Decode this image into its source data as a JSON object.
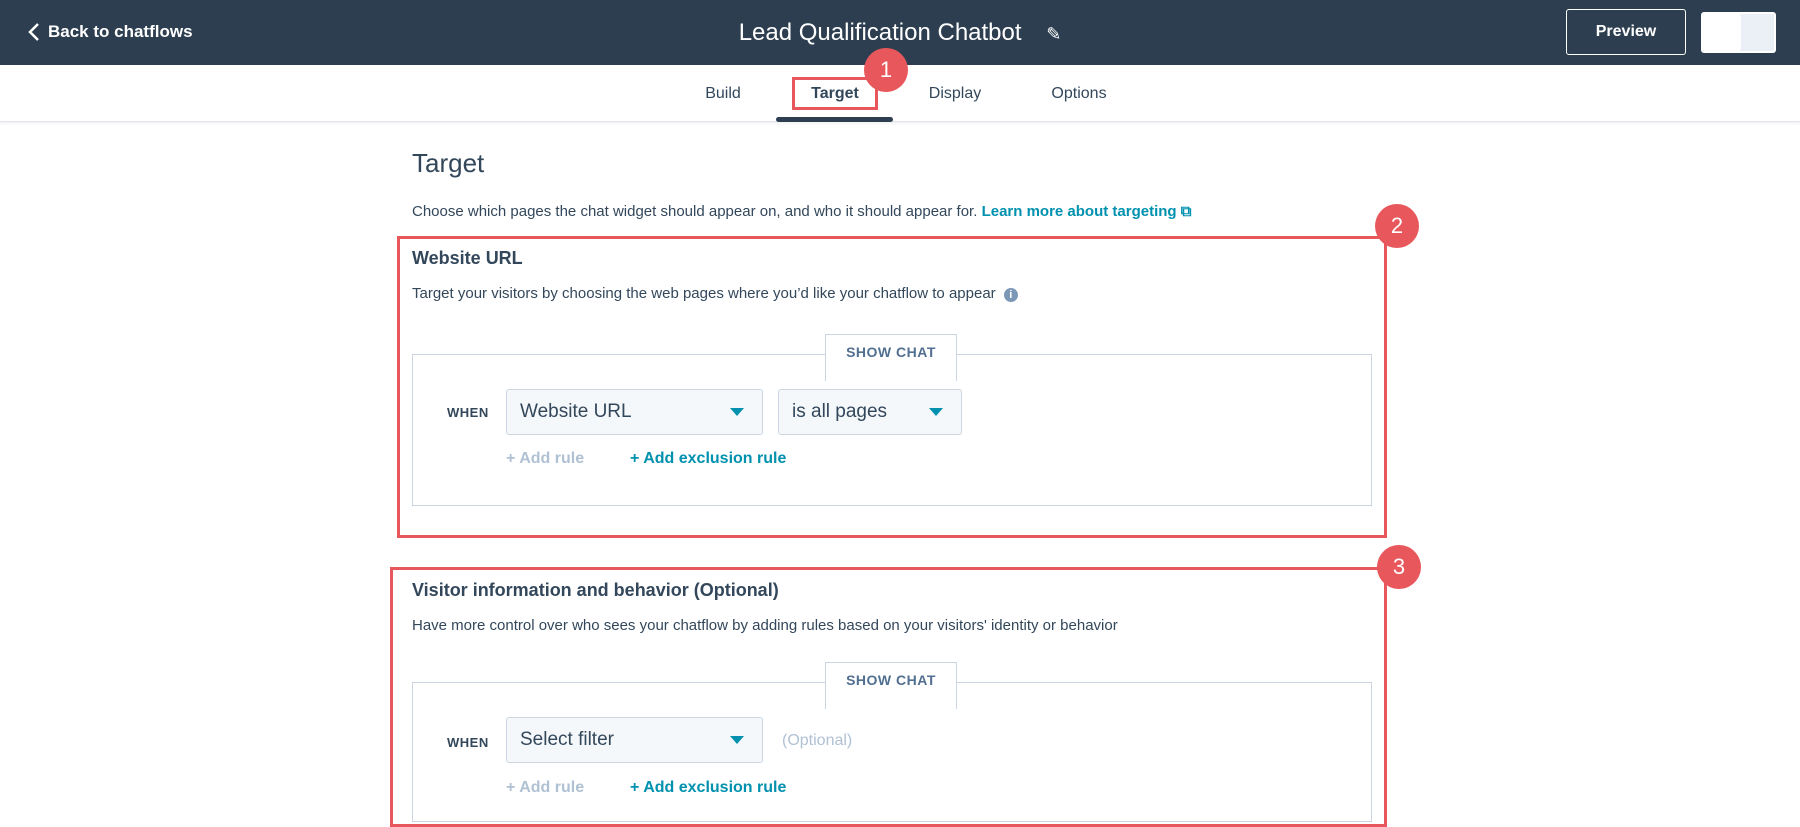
{
  "header": {
    "back_label": "Back to chatflows",
    "title": "Lead Qualification Chatbot",
    "preview_label": "Preview"
  },
  "tabs": [
    {
      "label": "Build"
    },
    {
      "label": "Target"
    },
    {
      "label": "Display"
    },
    {
      "label": "Options"
    }
  ],
  "annotations": [
    "1",
    "2",
    "3"
  ],
  "page": {
    "title": "Target",
    "description": "Choose which pages the chat widget should appear on, and who it should appear for.",
    "learn_more": "Learn more about targeting"
  },
  "website_url": {
    "heading": "Website URL",
    "description": "Target your visitors by choosing the web pages where you’d like your chatflow to appear",
    "show_chat": "SHOW CHAT",
    "when": "WHEN",
    "filter": "Website URL",
    "condition": "is all pages",
    "add_rule": "Add rule",
    "add_exclusion": "Add exclusion rule"
  },
  "visitor": {
    "heading": "Visitor information and behavior (Optional)",
    "description": "Have more control over who sees your chatflow by adding rules based on your visitors' identity or behavior",
    "show_chat": "SHOW CHAT",
    "when": "WHEN",
    "filter": "Select filter",
    "optional": "(Optional)",
    "add_rule": "Add rule",
    "add_exclusion": "Add exclusion rule"
  }
}
